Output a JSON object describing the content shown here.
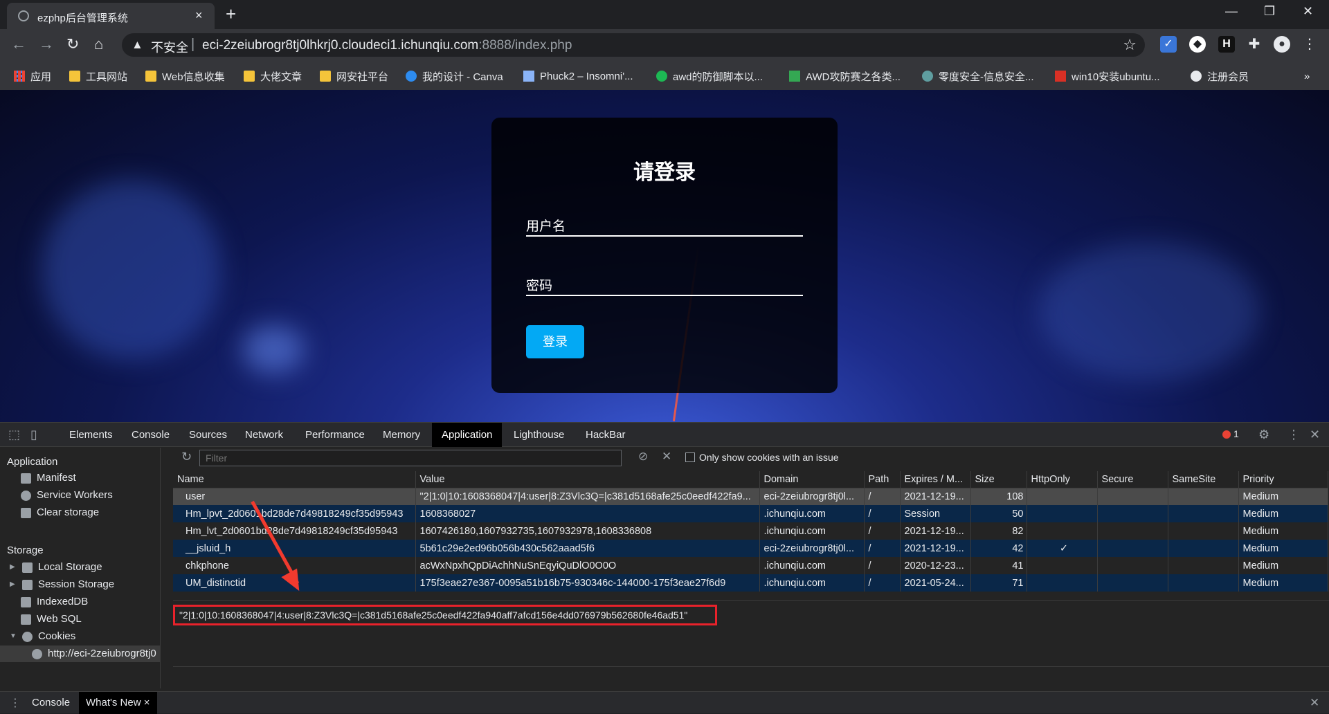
{
  "browser": {
    "tab_title": "ezphp后台管理系统",
    "tab_close": "×",
    "new_tab": "+",
    "window": {
      "minimize": "—",
      "restore": "❐",
      "close": "✕"
    }
  },
  "toolbar": {
    "back": "←",
    "forward": "→",
    "reload": "↻",
    "home": "⌂",
    "security_label": "不安全",
    "separator": "|",
    "url_host": "eci-2zeiubrogr8tj0lhkrj0.cloudeci1.ichunqiu.com",
    "url_rest": ":8888/index.php",
    "menu": "⋮"
  },
  "bookmarks": [
    {
      "label": "应用",
      "icon": "apps-grid-icon"
    },
    {
      "label": "工具网站",
      "icon": "folder-icon"
    },
    {
      "label": "Web信息收集",
      "icon": "folder-icon"
    },
    {
      "label": "大佬文章",
      "icon": "folder-icon"
    },
    {
      "label": "网安社平台",
      "icon": "folder-icon"
    },
    {
      "label": "我的设计 - Canva",
      "icon": "canva-icon"
    },
    {
      "label": "Phuck2 – Insomni'...",
      "icon": "page-icon"
    },
    {
      "label": "awd的防御脚本以...",
      "icon": "n-icon"
    },
    {
      "label": "AWD攻防赛之各类...",
      "icon": "bars-icon"
    },
    {
      "label": "零度安全-信息安全...",
      "icon": "gear-bookmark-icon"
    },
    {
      "label": "win10安装ubuntu...",
      "icon": "jian-icon"
    },
    {
      "label": "注册会员",
      "icon": "globe-icon"
    }
  ],
  "bookmarks_more": "»",
  "login": {
    "title": "请登录",
    "username_placeholder": "用户名",
    "password_placeholder": "密码",
    "submit": "登录"
  },
  "devtools": {
    "tabs": [
      "Elements",
      "Console",
      "Sources",
      "Network",
      "Performance",
      "Memory",
      "Application",
      "Lighthouse",
      "HackBar"
    ],
    "active_tab": "Application",
    "error_count": "1",
    "sidebar": {
      "application_header": "Application",
      "application_items": [
        "Manifest",
        "Service Workers",
        "Clear storage"
      ],
      "storage_header": "Storage",
      "storage_items": [
        "Local Storage",
        "Session Storage",
        "IndexedDB",
        "Web SQL",
        "Cookies"
      ],
      "cookie_origin": "http://eci-2zeiubrogr8tj0"
    },
    "filter_placeholder": "Filter",
    "only_issue_label": "Only show cookies with an issue",
    "columns": [
      "Name",
      "Value",
      "Domain",
      "Path",
      "Expires / M...",
      "Size",
      "HttpOnly",
      "Secure",
      "SameSite",
      "Priority"
    ],
    "rows": [
      {
        "name": "user",
        "value": "\"2|1:0|10:1608368047|4:user|8:Z3Vlc3Q=|c381d5168afe25c0eedf422fa9...",
        "domain": "eci-2zeiubrogr8tj0l...",
        "path": "/",
        "expires": "2021-12-19...",
        "size": "108",
        "httponly": "",
        "secure": "",
        "samesite": "",
        "priority": "Medium"
      },
      {
        "name": "Hm_lpvt_2d0601bd28de7d49818249cf35d95943",
        "value": "1608368027",
        "domain": ".ichunqiu.com",
        "path": "/",
        "expires": "Session",
        "size": "50",
        "httponly": "",
        "secure": "",
        "samesite": "",
        "priority": "Medium"
      },
      {
        "name": "Hm_lvt_2d0601bd28de7d49818249cf35d95943",
        "value": "1607426180,1607932735,1607932978,1608336808",
        "domain": ".ichunqiu.com",
        "path": "/",
        "expires": "2021-12-19...",
        "size": "82",
        "httponly": "",
        "secure": "",
        "samesite": "",
        "priority": "Medium"
      },
      {
        "name": "__jsluid_h",
        "value": "5b61c29e2ed96b056b430c562aaad5f6",
        "domain": "eci-2zeiubrogr8tj0l...",
        "path": "/",
        "expires": "2021-12-19...",
        "size": "42",
        "httponly": "✓",
        "secure": "",
        "samesite": "",
        "priority": "Medium"
      },
      {
        "name": "chkphone",
        "value": "acWxNpxhQpDiAchhNuSnEqyiQuDlO0O0O",
        "domain": ".ichunqiu.com",
        "path": "/",
        "expires": "2020-12-23...",
        "size": "41",
        "httponly": "",
        "secure": "",
        "samesite": "",
        "priority": "Medium"
      },
      {
        "name": "UM_distinctid",
        "value": "175f3eae27e367-0095a51b16b75-930346c-144000-175f3eae27f6d9",
        "domain": ".ichunqiu.com",
        "path": "/",
        "expires": "2021-05-24...",
        "size": "71",
        "httponly": "",
        "secure": "",
        "samesite": "",
        "priority": "Medium"
      }
    ],
    "selected_value": "\"2|1:0|10:1608368047|4:user|8:Z3Vlc3Q=|c381d5168afe25c0eedf422fa940aff7afcd156e4dd076979b562680fe46ad51\"",
    "drawer_tabs": [
      "Console",
      "What's New"
    ],
    "drawer_active": "What's New",
    "drawer_tab_close": "×"
  }
}
